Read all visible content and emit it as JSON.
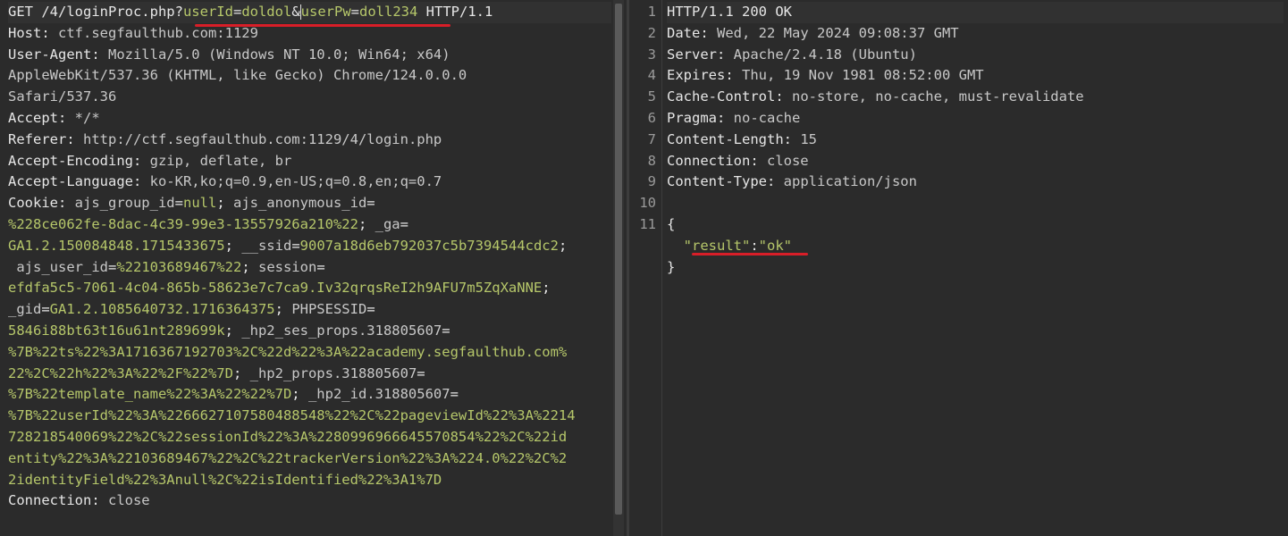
{
  "request": {
    "lines": [
      [
        {
          "t": "GET /4/loginProc.php?",
          "c": "k"
        },
        {
          "t": "userId",
          "c": "g"
        },
        {
          "t": "=",
          "c": "k"
        },
        {
          "t": "doldol",
          "c": "g"
        },
        {
          "t": "&",
          "c": "k"
        },
        {
          "t": "userPw",
          "c": "g"
        },
        {
          "t": "=",
          "c": "k"
        },
        {
          "t": "doll234",
          "c": "g"
        },
        {
          "t": " HTTP/1.1",
          "c": "k"
        }
      ],
      [
        {
          "t": "Host: ",
          "c": "k"
        },
        {
          "t": "ctf.segfaulthub.com:1129",
          "c": "v"
        }
      ],
      [
        {
          "t": "User-Agent: ",
          "c": "k"
        },
        {
          "t": "Mozilla/5.0 (Windows NT 10.0; Win64; x64)",
          "c": "v"
        }
      ],
      [
        {
          "t": "AppleWebKit/537.36 (KHTML, like Gecko) Chrome/124.0.0.0",
          "c": "v"
        }
      ],
      [
        {
          "t": "Safari/537.36",
          "c": "v"
        }
      ],
      [
        {
          "t": "Accept: ",
          "c": "k"
        },
        {
          "t": "*/*",
          "c": "v"
        }
      ],
      [
        {
          "t": "Referer: ",
          "c": "k"
        },
        {
          "t": "http://ctf.segfaulthub.com:1129/4/login.php",
          "c": "v"
        }
      ],
      [
        {
          "t": "Accept-Encoding: ",
          "c": "k"
        },
        {
          "t": "gzip, deflate, br",
          "c": "v"
        }
      ],
      [
        {
          "t": "Accept-Language: ",
          "c": "k"
        },
        {
          "t": "ko-KR,ko;q=0.9,en-US;q=0.8,en;q=0.7",
          "c": "v"
        }
      ],
      [
        {
          "t": "Cookie: ",
          "c": "k"
        },
        {
          "t": "ajs_group_id",
          "c": "g2"
        },
        {
          "t": "=",
          "c": "k"
        },
        {
          "t": "null",
          "c": "g"
        },
        {
          "t": "; ",
          "c": "k"
        },
        {
          "t": "ajs_anonymous_id",
          "c": "g2"
        },
        {
          "t": "=",
          "c": "k"
        }
      ],
      [
        {
          "t": "%228ce062fe-8dac-4c39-99e3-13557926a210%22",
          "c": "g"
        },
        {
          "t": "; ",
          "c": "k"
        },
        {
          "t": "_ga",
          "c": "g2"
        },
        {
          "t": "=",
          "c": "k"
        }
      ],
      [
        {
          "t": "GA1.2.150084848.1715433675",
          "c": "g"
        },
        {
          "t": "; ",
          "c": "k"
        },
        {
          "t": "__ssid",
          "c": "g2"
        },
        {
          "t": "=",
          "c": "k"
        },
        {
          "t": "9007a18d6eb792037c5b7394544cdc2",
          "c": "g"
        },
        {
          "t": ";",
          "c": "k"
        }
      ],
      [
        {
          "t": " ajs_user_id",
          "c": "g2"
        },
        {
          "t": "=",
          "c": "k"
        },
        {
          "t": "%22103689467%22",
          "c": "g"
        },
        {
          "t": "; ",
          "c": "k"
        },
        {
          "t": "session",
          "c": "g2"
        },
        {
          "t": "=",
          "c": "k"
        }
      ],
      [
        {
          "t": "efdfa5c5-7061-4c04-865b-58623e7c7ca9.Iv32qrqsReI2h9AFU7m5ZqXaNNE",
          "c": "g"
        },
        {
          "t": ";",
          "c": "k"
        }
      ],
      [
        {
          "t": "_gid",
          "c": "g2"
        },
        {
          "t": "=",
          "c": "k"
        },
        {
          "t": "GA1.2.1085640732.1716364375",
          "c": "g"
        },
        {
          "t": "; ",
          "c": "k"
        },
        {
          "t": "PHPSESSID",
          "c": "g2"
        },
        {
          "t": "=",
          "c": "k"
        }
      ],
      [
        {
          "t": "5846i88bt63t16u61nt289699k",
          "c": "g"
        },
        {
          "t": "; ",
          "c": "k"
        },
        {
          "t": "_hp2_ses_props.318805607",
          "c": "g2"
        },
        {
          "t": "=",
          "c": "k"
        }
      ],
      [
        {
          "t": "%7B%22ts%22%3A1716367192703%2C%22d%22%3A%22academy.segfaulthub.com%",
          "c": "g"
        }
      ],
      [
        {
          "t": "22%2C%22h%22%3A%22%2F%22%7D",
          "c": "g"
        },
        {
          "t": "; ",
          "c": "k"
        },
        {
          "t": "_hp2_props.318805607",
          "c": "g2"
        },
        {
          "t": "=",
          "c": "k"
        }
      ],
      [
        {
          "t": "%7B%22template_name%22%3A%22%22%7D",
          "c": "g"
        },
        {
          "t": "; ",
          "c": "k"
        },
        {
          "t": "_hp2_id.318805607",
          "c": "g2"
        },
        {
          "t": "=",
          "c": "k"
        }
      ],
      [
        {
          "t": "%7B%22userId%22%3A%2266627107580488548%22%2C%22pageviewId%22%3A%2214",
          "c": "g"
        }
      ],
      [
        {
          "t": "728218540069%22%2C%22sessionId%22%3A%2280996966645570854%22%2C%22id",
          "c": "g"
        }
      ],
      [
        {
          "t": "entity%22%3A%22103689467%22%2C%22trackerVersion%22%3A%224.0%22%2C%2",
          "c": "g"
        }
      ],
      [
        {
          "t": "2identityField%22%3Anull%2C%22isIdentified%22%3A1%7D",
          "c": "g"
        }
      ],
      [
        {
          "t": "Connection: ",
          "c": "k"
        },
        {
          "t": "close",
          "c": "v"
        }
      ]
    ]
  },
  "response": {
    "line_numbers": [
      "1",
      "2",
      "3",
      "4",
      "5",
      "6",
      "7",
      "8",
      "9",
      "10",
      "11"
    ],
    "lines": [
      [
        {
          "t": "HTTP/1.1 200 OK",
          "c": "k"
        }
      ],
      [
        {
          "t": "Date: ",
          "c": "k"
        },
        {
          "t": "Wed, 22 May 2024 09:08:37 GMT",
          "c": "v"
        }
      ],
      [
        {
          "t": "Server: ",
          "c": "k"
        },
        {
          "t": "Apache/2.4.18 (Ubuntu)",
          "c": "v"
        }
      ],
      [
        {
          "t": "Expires: ",
          "c": "k"
        },
        {
          "t": "Thu, 19 Nov 1981 08:52:00 GMT",
          "c": "v"
        }
      ],
      [
        {
          "t": "Cache-Control: ",
          "c": "k"
        },
        {
          "t": "no-store, no-cache, must-revalidate",
          "c": "v"
        }
      ],
      [
        {
          "t": "Pragma: ",
          "c": "k"
        },
        {
          "t": "no-cache",
          "c": "v"
        }
      ],
      [
        {
          "t": "Content-Length: ",
          "c": "k"
        },
        {
          "t": "15",
          "c": "v"
        }
      ],
      [
        {
          "t": "Connection: ",
          "c": "k"
        },
        {
          "t": "close",
          "c": "v"
        }
      ],
      [
        {
          "t": "Content-Type: ",
          "c": "k"
        },
        {
          "t": "application/json",
          "c": "v"
        }
      ],
      [
        {
          "t": "",
          "c": "k"
        }
      ],
      [
        {
          "t": "{",
          "c": "k"
        }
      ],
      [
        {
          "t": "  ",
          "c": "k"
        },
        {
          "t": "\"result\"",
          "c": "g"
        },
        {
          "t": ":",
          "c": "k"
        },
        {
          "t": "\"ok\"",
          "c": "g"
        }
      ],
      [
        {
          "t": "}",
          "c": "k"
        }
      ]
    ]
  }
}
